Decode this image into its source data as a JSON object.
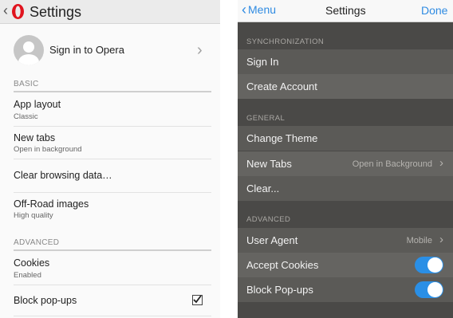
{
  "left": {
    "app_title": "Settings",
    "signin_label": "Sign in to Opera",
    "sections": {
      "basic": "BASIC",
      "advanced": "ADVANCED"
    },
    "items": {
      "app_layout": {
        "title": "App layout",
        "subtitle": "Classic"
      },
      "new_tabs": {
        "title": "New tabs",
        "subtitle": "Open in background"
      },
      "clear_browsing": {
        "title": "Clear browsing data…"
      },
      "off_road": {
        "title": "Off-Road images",
        "subtitle": "High quality"
      },
      "cookies": {
        "title": "Cookies",
        "subtitle": "Enabled"
      },
      "block_popups": {
        "title": "Block pop-ups",
        "checked": true
      }
    },
    "icons": [
      "chevron-left-icon",
      "opera-logo-icon",
      "avatar-icon",
      "chevron-right-icon",
      "checkbox-icon"
    ]
  },
  "right": {
    "nav": {
      "back_label": "Menu",
      "title": "Settings",
      "done_label": "Done"
    },
    "sections": {
      "sync": "SYNCHRONIZATION",
      "general": "GENERAL",
      "advanced": "ADVANCED"
    },
    "rows": {
      "sign_in": "Sign In",
      "create_account": "Create Account",
      "change_theme": "Change Theme",
      "new_tabs": {
        "label": "New Tabs",
        "value": "Open in Background"
      },
      "clear": "Clear...",
      "user_agent": {
        "label": "User Agent",
        "value": "Mobile"
      },
      "accept_cookies": {
        "label": "Accept Cookies",
        "on": true
      },
      "block_popups": {
        "label": "Block Pop-ups",
        "on": true
      }
    },
    "colors": {
      "accent": "#2f8be2",
      "toggle_on": "#2a8fe6",
      "row_bg": "#5b5a57"
    }
  }
}
